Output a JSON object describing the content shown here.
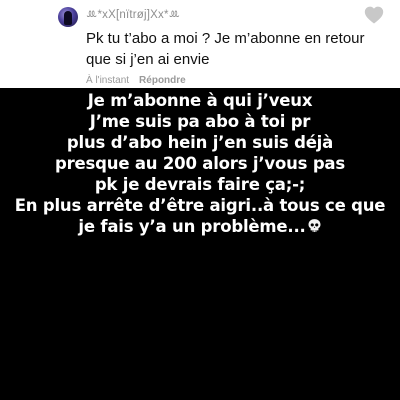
{
  "comment": {
    "username": "ꔛ*xX[nïtrøj]Xx*ꔛ",
    "text": "Pk tu t’abo a moi ? Je m’abonne en retour que si j’en ai envie",
    "time": "À l'instant",
    "reply_label": "Répondre",
    "icons": {
      "avatar": "avatar-image",
      "like": "heart-outline-icon"
    }
  },
  "overlay": {
    "lines": [
      "Je m’abonne à qui j’veux",
      "J’me suis pa abo à toi pr",
      "plus d’abo hein j’en suis déjà",
      "presque au 200 alors j’vous pas",
      "pk je devrais faire ça;-;",
      "En plus arrête d’être aigri..à tous ce que",
      "je fais y’a un problème..."
    ],
    "trailing_emoji": "skull-icon"
  },
  "colors": {
    "background": "#000000",
    "card": "#ffffff",
    "meta_text": "#9a9a9a",
    "overlay_text": "#ffffff"
  }
}
